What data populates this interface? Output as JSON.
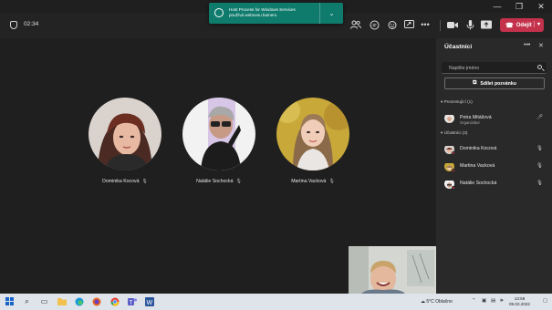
{
  "window": {
    "min_icon": "minimize-icon",
    "max_icon": "maximize-icon",
    "close_icon": "close-icon"
  },
  "meeting": {
    "timer": "02:34",
    "leave_label": "Odejít"
  },
  "toast": {
    "line1": "Host Process for Windows Services",
    "line2": "používá webovou kameru"
  },
  "participants_stage": [
    {
      "name": "Dominika Kocová"
    },
    {
      "name": "Natálie Sochocká"
    },
    {
      "name": "Martina Vacková"
    }
  ],
  "panel": {
    "title": "Účastníci",
    "search_placeholder": "Napište jméno",
    "share_label": "Sdílet pozvánku",
    "presenters_section": "Prezentující (1)",
    "attendees_section": "Účastníci (3)",
    "presenters": [
      {
        "name": "Petra Mitášová",
        "role": "Organizátor"
      }
    ],
    "attendees": [
      {
        "name": "Dominika Kocová"
      },
      {
        "name": "Martina Vacková"
      },
      {
        "name": "Natálie Sochocká"
      }
    ]
  },
  "taskbar": {
    "weather": "5°C  Oblačno",
    "time": "13:58",
    "date": "09.02.2022"
  },
  "colors": {
    "accent": "#6264a7",
    "leave": "#c4314b",
    "toast": "#0f7b6c",
    "background": "#1f1f1f",
    "panel": "#292929"
  }
}
